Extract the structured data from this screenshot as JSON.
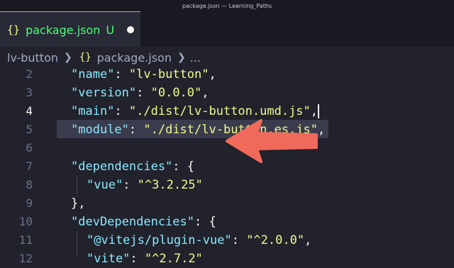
{
  "window": {
    "title": "package.json — Learning_Paths"
  },
  "tab": {
    "icon": "braces-icon",
    "file": "package.json",
    "status": "U"
  },
  "breadcrumb": {
    "folder": "lv-button",
    "file": "package.json",
    "more": "..."
  },
  "colors": {
    "key": "#8be9fd",
    "string": "#f1fa8c",
    "git_untracked": "#50fa7b",
    "arrow": "#f06a5c"
  },
  "lines": [
    {
      "n": "2",
      "key": "\"name\"",
      "value": "\"lv-button\"",
      "tail": ","
    },
    {
      "n": "3",
      "key": "\"version\"",
      "value": "\"0.0.0\"",
      "tail": ","
    },
    {
      "n": "4",
      "key": "\"main\"",
      "value": "\"./dist/lv-button.umd.js\"",
      "tail": ","
    },
    {
      "n": "5",
      "key": "\"module\"",
      "value": "\"./dist/lv-button.es.js\"",
      "tail": ","
    },
    {
      "n": "6"
    },
    {
      "n": "7",
      "key": "\"dependencies\"",
      "tail": ": {"
    },
    {
      "n": "8",
      "key": "\"vue\"",
      "value": "\"^3.2.25\""
    },
    {
      "n": "9",
      "text": "},"
    },
    {
      "n": "10",
      "key": "\"devDependencies\"",
      "tail": ": {"
    },
    {
      "n": "11",
      "key": "\"@vitejs/plugin-vue\"",
      "value": "\"^2.0.0\"",
      "tail": ","
    },
    {
      "n": "12",
      "key": "\"vite\"",
      "value": "\"^2.7.2\""
    }
  ],
  "active_line": "4"
}
